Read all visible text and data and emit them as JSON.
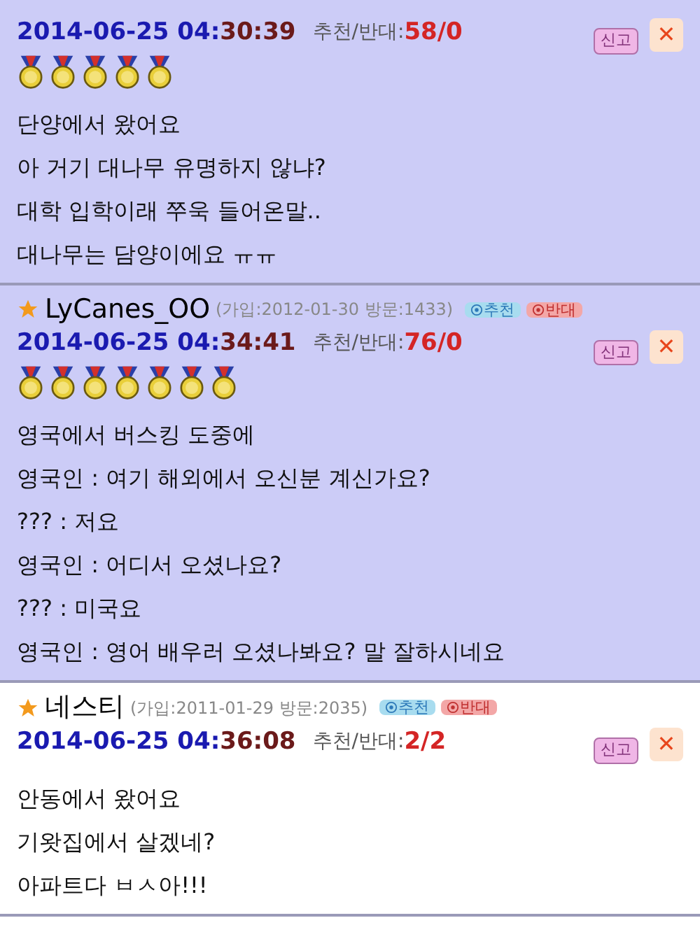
{
  "comments": [
    {
      "highlighted": true,
      "time_head": "2014-06-25 04:",
      "time_tail": "30:39",
      "votes_label": "추천/반대:",
      "votes": "58/0",
      "report_label": "신고",
      "close_label": "✕",
      "stars": 5,
      "lines": [
        "단양에서 왔어요",
        "아 거기 대나무 유명하지 않냐?",
        "대학 입학이래 쭈욱 들어온말..",
        "대나무는 담양이에요 ㅠㅠ"
      ]
    },
    {
      "highlighted": true,
      "author": "LyCanes_OO",
      "joined": "(가입:2012-01-30 방문:1433)",
      "recommend_label": "추천",
      "oppose_label": "반대",
      "time_head": "2014-06-25 04:",
      "time_tail": "34:41",
      "votes_label": "추천/반대:",
      "votes": "76/0",
      "report_label": "신고",
      "close_label": "✕",
      "stars": 7,
      "lines": [
        "영국에서 버스킹 도중에",
        "영국인 : 여기 해외에서 오신분 계신가요?",
        "??? : 저요",
        "영국인 : 어디서 오셨나요?",
        "??? : 미국요",
        "영국인 : 영어 배우러 오셨나봐요? 말 잘하시네요"
      ]
    },
    {
      "highlighted": false,
      "author": "네스티",
      "joined": "(가입:2011-01-29 방문:2035)",
      "recommend_label": "추천",
      "oppose_label": "반대",
      "time_head": "2014-06-25 04:",
      "time_tail": "36:08",
      "votes_label": "추천/반대:",
      "votes": "2/2",
      "report_label": "신고",
      "close_label": "✕",
      "lines": [
        "안동에서 왔어요",
        "기왓집에서 살겠네?",
        "아파트다 ㅂㅅ아!!!"
      ]
    }
  ]
}
